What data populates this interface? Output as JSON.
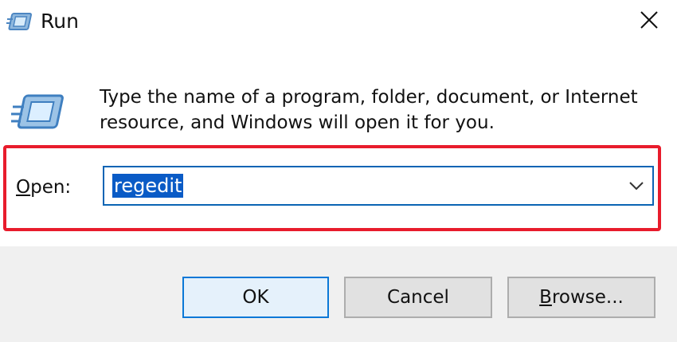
{
  "window": {
    "title": "Run",
    "close_label": "Close"
  },
  "description": "Type the name of a program, folder, document, or Internet resource, and Windows will open it for you.",
  "open": {
    "label_first": "O",
    "label_rest": "pen:",
    "value": "regedit",
    "highlight_color": "#e81c2c"
  },
  "buttons": {
    "ok": "OK",
    "cancel": "Cancel",
    "browse_first": "B",
    "browse_rest": "rowse..."
  },
  "icons": {
    "title_icon": "run-icon",
    "main_icon": "run-icon-large",
    "close": "close-icon",
    "dropdown": "chevron-down-icon"
  },
  "colors": {
    "accent": "#0a64b4",
    "selection": "#0a5bc6",
    "footer_bg": "#f0f0f0"
  }
}
